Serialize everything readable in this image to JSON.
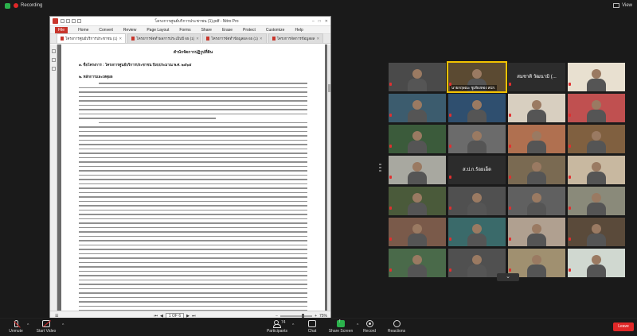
{
  "topbar": {
    "recording": "Recording",
    "view": "View"
  },
  "pdf": {
    "window_title": "โครงการศูนย์บริการประชาชน (1).pdf - Nitro Pro",
    "ribbon": [
      "File",
      "Home",
      "Convert",
      "Review",
      "Page Layout",
      "Forms",
      "Share",
      "Erase",
      "Protect",
      "Customize",
      "Help"
    ],
    "tabs": [
      "โครงการศูนย์บริการประชาชน (1)",
      "โครงการจัดทำผลการประเมินปี 65 (1)",
      "โครงการจัดทำข้อมูลผล 65 (1)",
      "โครงการจัดการข้อมูลผล"
    ],
    "page_header": "สำนักจัดการปฏิรูปที่ดิน",
    "section1": "๑. ชื่อโครงการ : โครงการศูนย์บริการประชาชน ปีงบประมาณ พ.ศ. ๒๕๖๕",
    "section2": "๒. หลักการและเหตุผล",
    "status": {
      "page": "1 OF 6",
      "zoom": "75%"
    }
  },
  "gallery": [
    {
      "name": "",
      "photo": "#4a4a4a"
    },
    {
      "name": "นายกฤษณะ ชูเสียงทอง สปก.",
      "photo": "#5b4a32",
      "active": true
    },
    {
      "name": "สมชาติ วัฒนามิ (...",
      "centered": true
    },
    {
      "name": "",
      "photo": "#e8e0d0"
    },
    {
      "name": "",
      "photo": "#3c5c6e"
    },
    {
      "name": "",
      "photo": "#2f4f6f"
    },
    {
      "name": "",
      "photo": "#d8cfc0"
    },
    {
      "name": "",
      "photo": "#c05050"
    },
    {
      "name": "",
      "photo": "#3b5b3b"
    },
    {
      "name": "",
      "photo": "#6b6b6b"
    },
    {
      "name": "",
      "photo": "#b07050"
    },
    {
      "name": "",
      "photo": "#806040"
    },
    {
      "name": "",
      "photo": "#a8a8a0"
    },
    {
      "name": "ส.ป.ก.ร้อยเอ็ด",
      "centered": true
    },
    {
      "name": "",
      "photo": "#7a6a52"
    },
    {
      "name": "",
      "photo": "#c8b8a0"
    },
    {
      "name": "",
      "photo": "#4a5a3a"
    },
    {
      "name": "",
      "photo": "#505050"
    },
    {
      "name": "",
      "photo": "#606060"
    },
    {
      "name": "",
      "photo": "#8a8a7a"
    },
    {
      "name": "",
      "photo": "#7a5a4a"
    },
    {
      "name": "",
      "photo": "#3a6a6a"
    },
    {
      "name": "",
      "photo": "#b0a090"
    },
    {
      "name": "",
      "photo": "#5a4a3a"
    },
    {
      "name": "",
      "photo": "#4a6a4a"
    },
    {
      "name": "",
      "photo": "#505050"
    },
    {
      "name": "",
      "photo": "#a09070"
    },
    {
      "name": "",
      "photo": "#d0d8d0"
    }
  ],
  "toolbar": {
    "unmute": "Unmute",
    "start_video": "Start Video",
    "participants": "Participants",
    "participants_count": "74",
    "chat": "Chat",
    "share_screen": "Share Screen",
    "record": "Record",
    "reactions": "Reactions",
    "leave": "Leave"
  },
  "colors": {
    "accent_green": "#2bb24c",
    "leave_red": "#e02828",
    "active_speaker": "#f2c200",
    "nitro_red": "#c8362c"
  }
}
